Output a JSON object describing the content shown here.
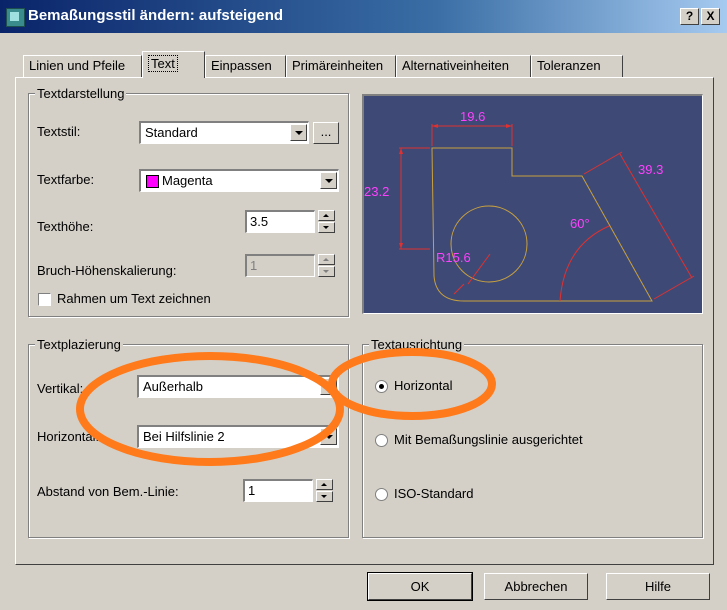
{
  "window": {
    "title": "Bemaßungsstil ändern: aufsteigend",
    "help_button": "?",
    "close_button": "X"
  },
  "tabs": [
    {
      "label": "Linien und Pfeile"
    },
    {
      "label": "Text"
    },
    {
      "label": "Einpassen"
    },
    {
      "label": "Primäreinheiten"
    },
    {
      "label": "Alternativeinheiten"
    },
    {
      "label": "Toleranzen"
    }
  ],
  "selected_tab": "Text",
  "textdarstellung": {
    "group_label": "Textdarstellung",
    "textstil": {
      "label": "Textstil:",
      "value": "Standard",
      "browse": "..."
    },
    "textfarbe": {
      "label": "Textfarbe:",
      "value": "Magenta",
      "swatch_color": "#ff00ff"
    },
    "texthoehe": {
      "label": "Texthöhe:",
      "value": "3.5"
    },
    "bruch": {
      "label": "Bruch-Höhenskalierung:",
      "value": "1"
    },
    "rahmen": {
      "label": "Rahmen um Text zeichnen",
      "checked": false
    }
  },
  "preview": {
    "dim_top": "19.6",
    "dim_left": "23.2",
    "dim_right": "39.3",
    "dim_angle": "60°",
    "dim_radius": "R15.6",
    "background_color": "#3e4a75",
    "geometry_color": "#c8a040",
    "dim_line_color": "#e03030",
    "text_color": "#ff40ff"
  },
  "textplazierung": {
    "group_label": "Textplazierung",
    "vertikal": {
      "label": "Vertikal:",
      "value": "Außerhalb"
    },
    "horizontal": {
      "label": "Horizontal:",
      "value": "Bei Hilfslinie 2"
    },
    "abstand": {
      "label": "Abstand von Bem.-Linie:",
      "value": "1"
    }
  },
  "textausrichtung": {
    "group_label": "Textausrichtung",
    "options": [
      {
        "label": "Horizontal",
        "selected": true
      },
      {
        "label": "Mit Bemaßungslinie ausgerichtet",
        "selected": false
      },
      {
        "label": "ISO-Standard",
        "selected": false
      }
    ]
  },
  "buttons": {
    "ok": "OK",
    "cancel": "Abbrechen",
    "help": "Hilfe"
  },
  "annotation_color": "#ff7a1a"
}
